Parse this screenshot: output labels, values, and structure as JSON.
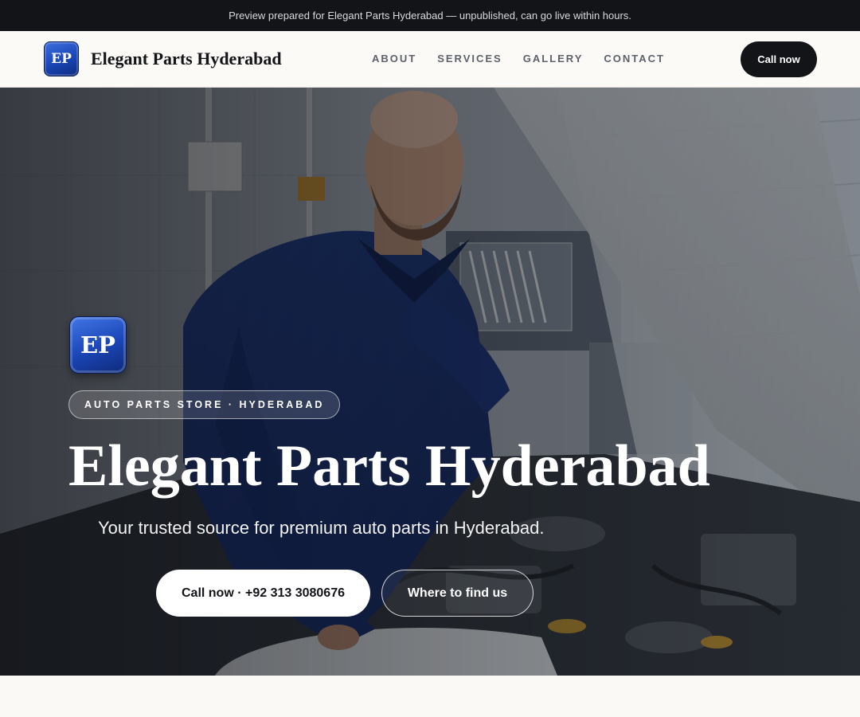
{
  "banner": {
    "text": "Preview prepared for Elegant Parts Hyderabad — unpublished, can go live within hours."
  },
  "header": {
    "logo_initials": "EP",
    "brand_name": "Elegant Parts Hyderabad",
    "nav": [
      {
        "label": "ABOUT"
      },
      {
        "label": "SERVICES"
      },
      {
        "label": "GALLERY"
      },
      {
        "label": "CONTACT"
      }
    ],
    "call_label": "Call now"
  },
  "hero": {
    "image": "mechanic-working-on-car-engine",
    "badge_initials": "EP",
    "tag": "AUTO PARTS STORE · HYDERABAD",
    "title": "Elegant Parts Hyderabad",
    "subtitle": "Your trusted source for premium auto parts in Hyderabad.",
    "primary_cta": "Call now · +92 313 3080676",
    "secondary_cta": "Where to find us"
  },
  "colors": {
    "banner_bg": "#121418",
    "accent_dark": "#121418",
    "logo_blue": "#1a45b6",
    "page_bg": "#faf9f6"
  }
}
